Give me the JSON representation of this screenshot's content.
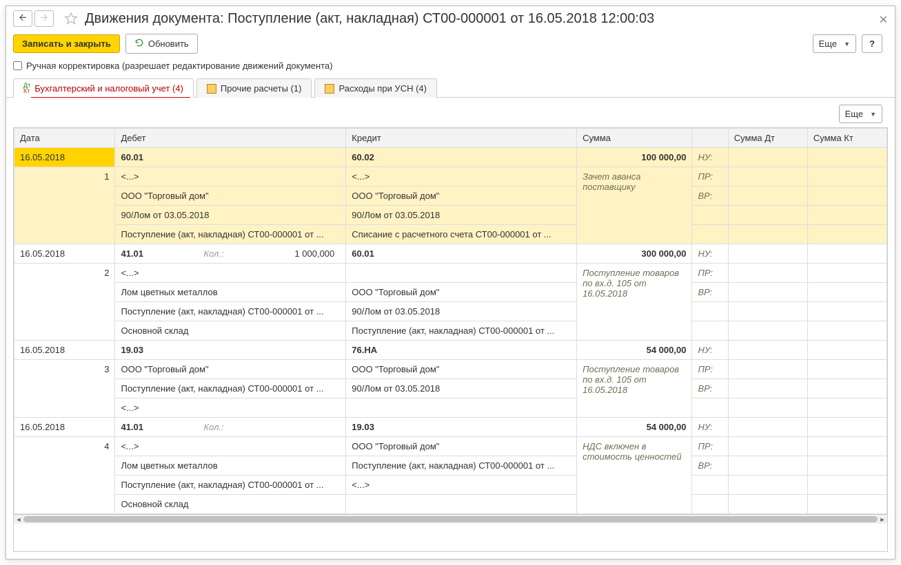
{
  "window": {
    "title": "Движения документа: Поступление (акт, накладная) СТ00-000001 от 16.05.2018 12:00:03"
  },
  "toolbar": {
    "save_close": "Записать и закрыть",
    "refresh": "Обновить",
    "more": "Еще",
    "help": "?"
  },
  "manual_correction": {
    "label": "Ручная корректировка (разрешает редактирование движений документа)",
    "checked": false
  },
  "tabs": [
    {
      "label": "Бухгалтерский и налоговый учет (4)"
    },
    {
      "label": "Прочие расчеты (1)"
    },
    {
      "label": "Расходы при УСН (4)"
    }
  ],
  "content_toolbar": {
    "more": "Еще"
  },
  "columns": {
    "date": "Дата",
    "debit": "Дебет",
    "credit": "Кредит",
    "sum": "Сумма",
    "sum_dt": "Сумма Дт",
    "sum_kt": "Сумма Кт"
  },
  "tax_labels": {
    "nu": "НУ:",
    "pr": "ПР:",
    "vr": "ВР:"
  },
  "qty_label": "Кол.:",
  "rows": [
    {
      "date": "16.05.2018",
      "n": "1",
      "debit_account": "60.01",
      "debit_lines": [
        "<...>",
        "ООО \"Торговый дом\"",
        "90/Лом от 03.05.2018",
        "Поступление (акт, накладная) СТ00-000001 от ..."
      ],
      "credit_account": "60.02",
      "credit_lines": [
        "<...>",
        "ООО \"Торговый дом\"",
        "90/Лом от 03.05.2018",
        "Списание с расчетного счета СТ00-000001 от ..."
      ],
      "sum": "100 000,00",
      "sum_note": "Зачет аванса поставщику",
      "highlight": true
    },
    {
      "date": "16.05.2018",
      "n": "2",
      "debit_account": "41.01",
      "debit_qty": "1 000,000",
      "debit_lines": [
        "<...>",
        "Лом цветных металлов",
        "Поступление (акт, накладная) СТ00-000001 от ...",
        "Основной склад"
      ],
      "credit_account": "60.01",
      "credit_lines": [
        "",
        "ООО \"Торговый дом\"",
        "90/Лом от 03.05.2018",
        "Поступление (акт, накладная) СТ00-000001 от ..."
      ],
      "sum": "300 000,00",
      "sum_note": "Поступление товаров по вх.д. 105 от 16.05.2018"
    },
    {
      "date": "16.05.2018",
      "n": "3",
      "debit_account": "19.03",
      "debit_lines": [
        "ООО \"Торговый дом\"",
        "Поступление (акт, накладная) СТ00-000001 от ...",
        "<...>"
      ],
      "credit_account": "76.НА",
      "credit_lines": [
        "ООО \"Торговый дом\"",
        "90/Лом от 03.05.2018"
      ],
      "sum": "54 000,00",
      "sum_note": "Поступление товаров по вх.д. 105 от 16.05.2018"
    },
    {
      "date": "16.05.2018",
      "n": "4",
      "debit_account": "41.01",
      "debit_qty": "",
      "debit_lines": [
        "<...>",
        "Лом цветных металлов",
        "Поступление (акт, накладная) СТ00-000001 от ...",
        "Основной склад"
      ],
      "credit_account": "19.03",
      "credit_lines": [
        "ООО \"Торговый дом\"",
        "Поступление (акт, накладная) СТ00-000001 от ...",
        "<...>"
      ],
      "sum": "54 000,00",
      "sum_note": "НДС включен в стоимость ценностей"
    }
  ]
}
